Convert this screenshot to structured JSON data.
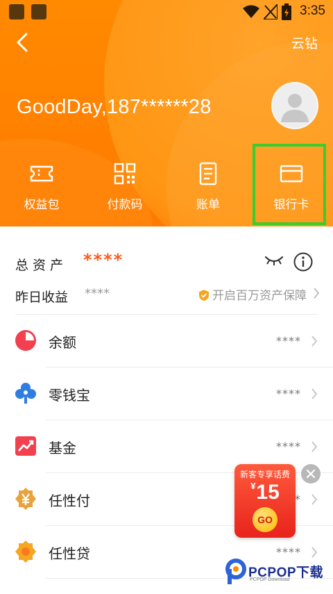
{
  "status_bar": {
    "time": "3:35"
  },
  "header": {
    "right_link": "云钻",
    "username": "GoodDay,187******28"
  },
  "quick_actions": [
    {
      "label": "权益包",
      "icon": "ticket-icon"
    },
    {
      "label": "付款码",
      "icon": "qr-code-icon"
    },
    {
      "label": "账单",
      "icon": "bill-icon"
    },
    {
      "label": "银行卡",
      "icon": "bank-card-icon",
      "highlighted": true
    }
  ],
  "assets": {
    "total_label": "总资产",
    "total_value": "****",
    "yesterday_label": "昨日收益",
    "yesterday_value": "****",
    "protect_text": "开启百万资产保障"
  },
  "products": [
    {
      "label": "余额",
      "value": "****",
      "icon": "pie-chart-icon",
      "color": "#f2404f"
    },
    {
      "label": "零钱宝",
      "value": "****",
      "icon": "clover-icon",
      "color": "#2f7de1"
    },
    {
      "label": "基金",
      "value": "****",
      "icon": "trend-up-icon",
      "color": "#f2404f"
    },
    {
      "label": "任性付",
      "value": "****",
      "icon": "yen-coin-icon",
      "color": "#e9a33d"
    },
    {
      "label": "任性贷",
      "value": "****",
      "icon": "flower-coin-icon",
      "color": "#f5a623"
    }
  ],
  "promo": {
    "title": "新客专享话费",
    "currency": "¥",
    "amount": "15",
    "go": "GO"
  },
  "watermark": {
    "text": "PCPOP下载",
    "sub": "PCPOP Download"
  },
  "colors": {
    "brand_orange": "#ff8a00",
    "highlight_green": "#3ecb2c",
    "accent_red": "#ff5a1a"
  }
}
